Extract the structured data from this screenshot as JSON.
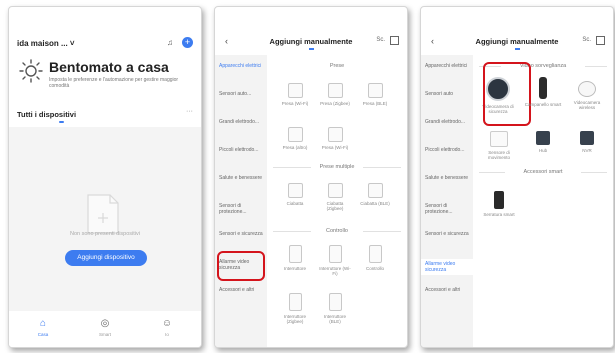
{
  "screen1": {
    "home_name": "ida maison ... ˅",
    "mic_icon": "mic-icon",
    "add_icon": "+",
    "welcome_title": "Bentomato a casa",
    "welcome_sub": "Imposta le preferenze e l'automazione per gestire maggior comodità",
    "all_devices": "Tutti i dispositivi",
    "more": "···",
    "no_devices": "Non sono presenti dispositivi",
    "add_device_button": "Aggiungi dispositivo",
    "tabs": [
      {
        "icon": "⌂",
        "label": "Casa",
        "color": "#3d7cf0"
      },
      {
        "icon": "◎",
        "label": "Smart",
        "color": "#666666"
      },
      {
        "icon": "☺",
        "label": "Io",
        "color": "#666666"
      }
    ]
  },
  "screen2": {
    "back": "‹",
    "title": "Aggiungi manualmente",
    "scan": "Sc.",
    "sidebar": [
      {
        "label": "Apparecchi elettrici"
      },
      {
        "label": "Sensori auto..."
      },
      {
        "label": "Grandi elettrodo..."
      },
      {
        "label": "Piccoli elettrodo..."
      },
      {
        "label": "Salute e benessere"
      },
      {
        "label": "Sensori di protezione..."
      },
      {
        "label": "Sensori e sicurezza"
      },
      {
        "label": "Allarme video sicurezza"
      },
      {
        "label": "Accessori e altri"
      }
    ],
    "sections": [
      "Prese",
      "Prese multiple",
      "Controllo"
    ],
    "devices": [
      {
        "label": "Presa (Wi-Fi)"
      },
      {
        "label": "Presa (Zigbee)"
      },
      {
        "label": "Presa (BLE)"
      },
      {
        "label": "Presa (altro)"
      },
      {
        "label": "Presa (Wi-Fi)"
      },
      {
        "label": "Presa (altro)"
      },
      {
        "label": "Ciabatta"
      },
      {
        "label": "Ciabatta (Zigbee)"
      },
      {
        "label": "Ciabatta (BLE)"
      },
      {
        "label": "Interruttore"
      },
      {
        "label": "Interruttore (Wi-Fi)"
      },
      {
        "label": "Controllo"
      },
      {
        "label": "Interruttore (Zigbee)"
      },
      {
        "label": "Interruttore (BLE)"
      }
    ]
  },
  "screen3": {
    "back": "‹",
    "title": "Aggiungi manualmente",
    "scan": "Sc.",
    "sidebar": [
      {
        "label": "Apparecchi elettrici"
      },
      {
        "label": "Sensori auto"
      },
      {
        "label": "Grandi elettrodo..."
      },
      {
        "label": "Piccoli elettrodo..."
      },
      {
        "label": "Salute e benessere"
      },
      {
        "label": "Sensori di protezione..."
      },
      {
        "label": "Sensori e sicurezza"
      },
      {
        "label": "Allarme video sicurezza"
      },
      {
        "label": "Accessori e altri"
      }
    ],
    "section1": "Video sorveglianza",
    "section2": "Accessori smart",
    "devices": [
      {
        "label": "Videocamera di sicurezza"
      },
      {
        "label": "Campanello smart"
      },
      {
        "label": "Videocamera wireless"
      },
      {
        "label": "Sensore di movimento"
      },
      {
        "label": "Hub"
      },
      {
        "label": "NVR"
      },
      {
        "label": "Serratura smart"
      }
    ]
  }
}
